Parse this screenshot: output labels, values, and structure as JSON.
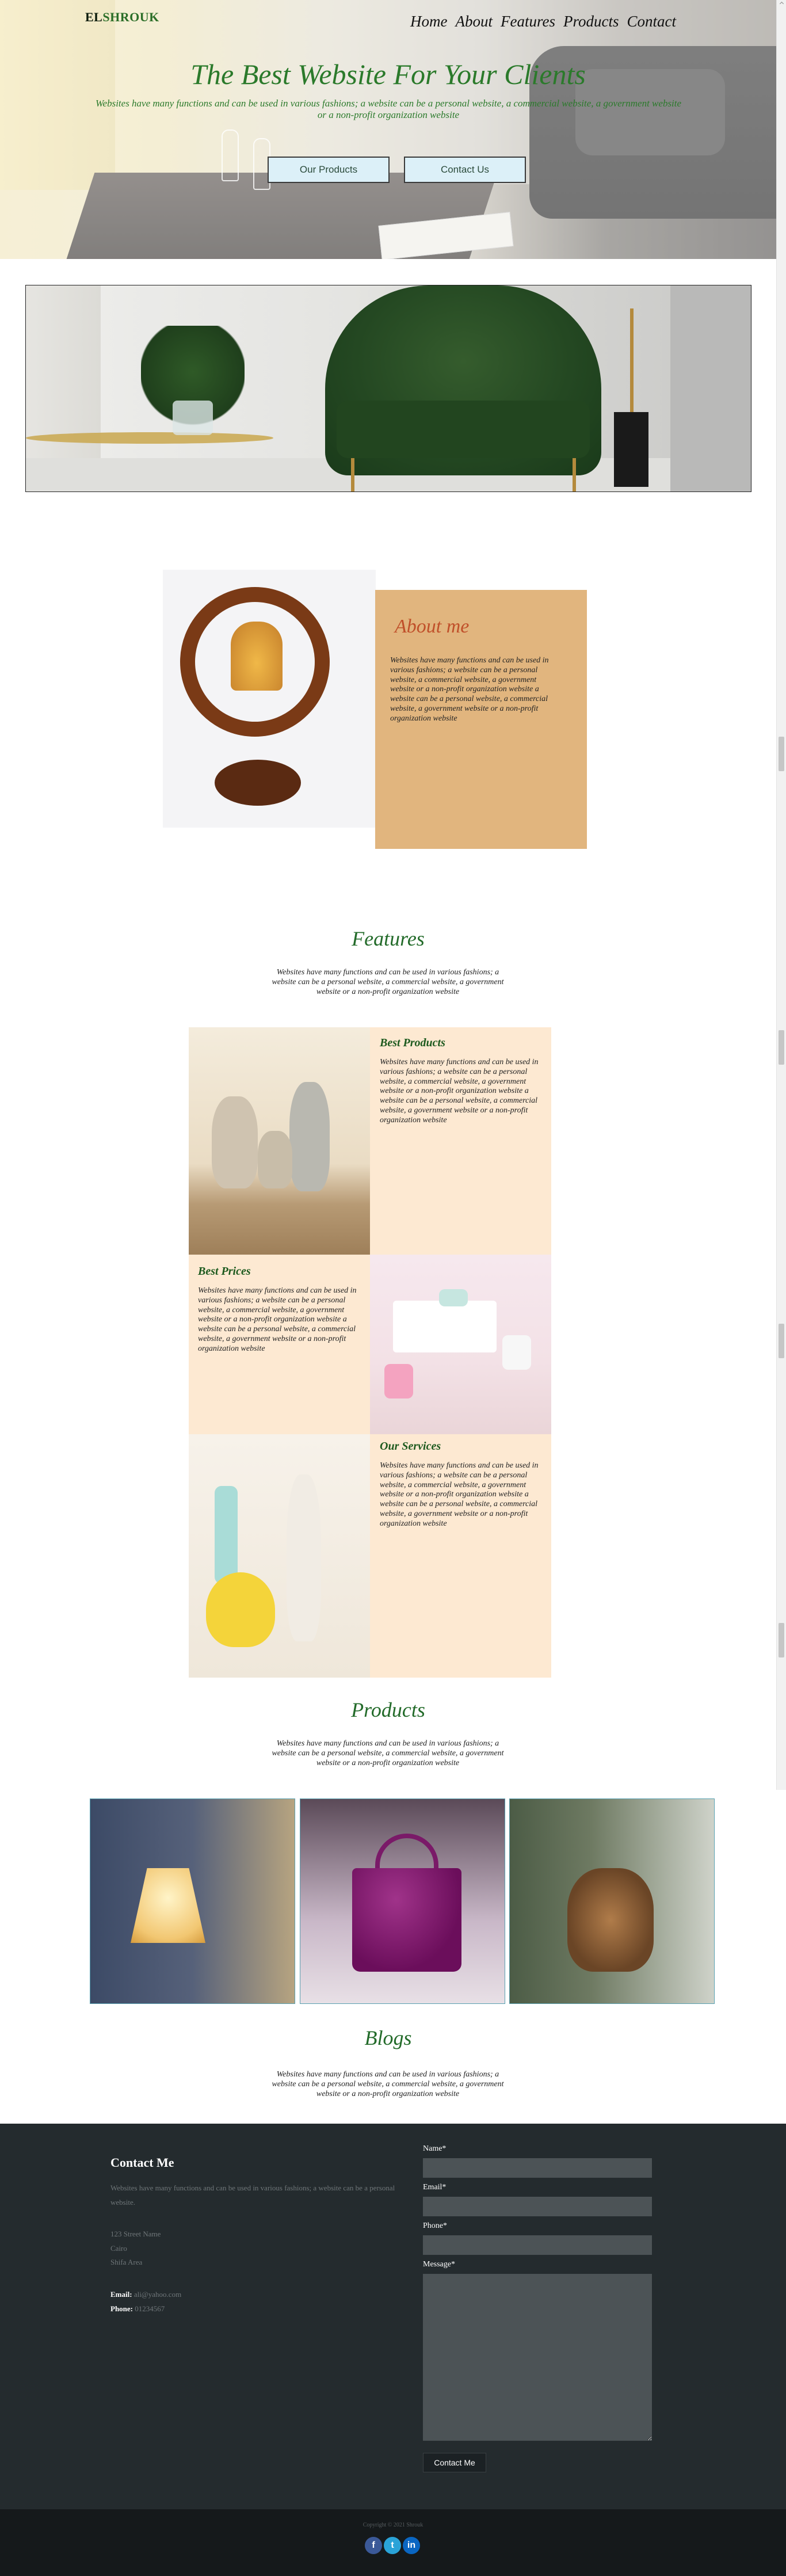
{
  "brand": {
    "part1": "EL",
    "part2": "SHROUK"
  },
  "nav": [
    "Home",
    "About",
    "Features",
    "Products",
    "Contact"
  ],
  "hero": {
    "title": "The Best Website For Your Clients",
    "subtitle": "Websites have many functions and can be used in various fashions; a website can be a personal website, a commercial website, a government website or a non-profit organization website",
    "btn_products": "Our Products",
    "btn_contact": "Contact Us"
  },
  "about": {
    "title": "About me",
    "text": "Websites have many functions and can be used in various fashions; a website can be a personal website, a commercial website, a government website or a non-profit organization website a website can be a personal website, a commercial website, a government website or a non-profit organization website"
  },
  "features": {
    "title": "Features",
    "subtitle": "Websites have many functions and can be used in various fashions; a website can be a personal website, a commercial website, a government website or a non-profit organization website",
    "items": [
      {
        "title": "Best Products",
        "text": "Websites have many functions and can be used in various fashions; a website can be a personal website, a commercial website, a government website or a non-profit organization website a website can be a personal website, a commercial website, a government website or a non-profit organization website"
      },
      {
        "title": "Best Prices",
        "text": "Websites have many functions and can be used in various fashions; a website can be a personal website, a commercial website, a government website or a non-profit organization website a website can be a personal website, a commercial website, a government website or a non-profit organization website"
      },
      {
        "title": "Our Services",
        "text": "Websites have many functions and can be used in various fashions; a website can be a personal website, a commercial website, a government website or a non-profit organization website a website can be a personal website, a commercial website, a government website or a non-profit organization website"
      }
    ]
  },
  "products": {
    "title": "Products",
    "subtitle": "Websites have many functions and can be used in various fashions; a website can be a personal website, a commercial website, a government website or a non-profit organization website"
  },
  "blogs": {
    "title": "Blogs",
    "subtitle": "Websites have many functions and can be used in various fashions; a website can be a personal website, a commercial website, a government website or a non-profit organization website"
  },
  "footer": {
    "title": "Contact Me",
    "text": "Websites have many functions and can be used in various fashions; a website can be a personal website.",
    "address": [
      "123 Street Name",
      "Cairo",
      "Shifa Area"
    ],
    "email_label": "Email:",
    "email_value": "ali@yahoo.com",
    "phone_label": "Phone:",
    "phone_value": "01234567",
    "form": {
      "name_label": "Name*",
      "email_label": "Email*",
      "phone_label": "Phone*",
      "message_label": "Message*",
      "submit": "Contact Me"
    }
  },
  "subfooter": {
    "copyright": "Copyright © 2021 Shrouk"
  },
  "socials": {
    "facebook": "f",
    "twitter": "t",
    "linkedin": "in"
  }
}
